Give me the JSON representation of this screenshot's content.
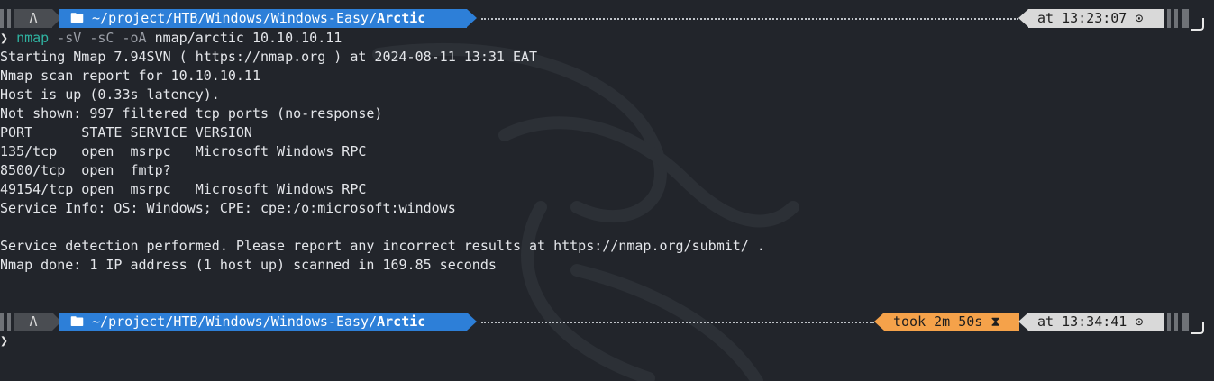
{
  "prompt1": {
    "os_icon": "Λ",
    "path_prefix": "🖿 ~/project/HTB/Windows/Windows-Easy/",
    "path_current": "Arctic",
    "time": "at 13:23:07 ⊙"
  },
  "command": {
    "prompt_char": "❯",
    "name": "nmap",
    "flags": "-sV -sC -oA",
    "args": "nmap/arctic 10.10.10.11"
  },
  "output": [
    "Starting Nmap 7.94SVN ( https://nmap.org ) at 2024-08-11 13:31 EAT",
    "Nmap scan report for 10.10.10.11",
    "Host is up (0.33s latency).",
    "Not shown: 997 filtered tcp ports (no-response)",
    "PORT      STATE SERVICE VERSION",
    "135/tcp   open  msrpc   Microsoft Windows RPC",
    "8500/tcp  open  fmtp?",
    "49154/tcp open  msrpc   Microsoft Windows RPC",
    "Service Info: OS: Windows; CPE: cpe:/o:microsoft:windows",
    "",
    "Service detection performed. Please report any incorrect results at https://nmap.org/submit/ .",
    "Nmap done: 1 IP address (1 host up) scanned in 169.85 seconds"
  ],
  "prompt2": {
    "os_icon": "Λ",
    "path_prefix": "🖿 ~/project/HTB/Windows/Windows-Easy/",
    "path_current": "Arctic",
    "took": "took 2m 50s ⧗",
    "time": "at 13:34:41 ⊙"
  },
  "final_prompt_char": "❯",
  "colors": {
    "background": "#22252b",
    "path_blue": "#2d7fd8",
    "took_orange": "#f5a24a",
    "time_gray": "#d9d9d9",
    "command_teal": "#2fb3a1"
  }
}
